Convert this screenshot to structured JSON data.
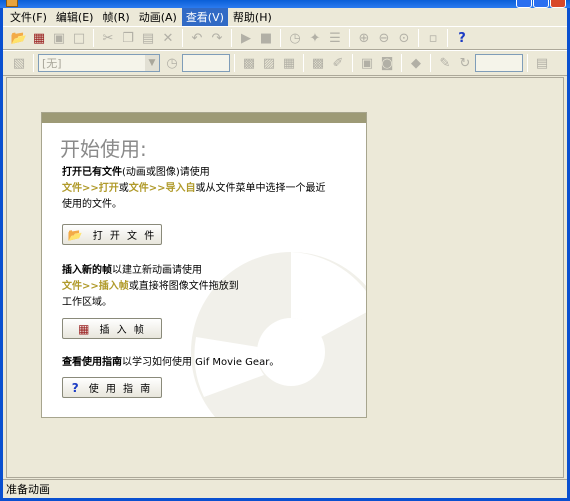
{
  "menu": [
    "文件(F)",
    "编辑(E)",
    "帧(R)",
    "动画(A)",
    "查看(V)",
    "帮助(H)"
  ],
  "toolbar2": {
    "combo_value": "[无]"
  },
  "panel": {
    "title": "开始使用:",
    "open": {
      "bold": "打开已有文件",
      "text1": "(动画或图像)请使用",
      "link1": "文件>>打开",
      "or": "或",
      "link2": "文件>>导入自",
      "text2": "或从文件菜单中选择一个最近",
      "text3": "使用的文件。",
      "button": "打 开 文 件"
    },
    "insert": {
      "bold": "插入新的帧",
      "text1": "以建立新动画请使用",
      "link": "文件>>插入帧",
      "text2": "或直接将图像文件拖放到",
      "text3": "工作区域。",
      "button": "插 入 帧"
    },
    "guide": {
      "bold": "查看使用指南",
      "text1": "以学习如何使用 Gif Movie Gear。",
      "button": "使 用 指 南"
    }
  },
  "status": "准备动画",
  "icons": [
    "app-icon",
    "open-folder-icon",
    "film-icon",
    "save-icon",
    "new-icon",
    "cut-icon",
    "copy-icon",
    "paste-icon",
    "delete-icon",
    "undo-icon",
    "redo-icon",
    "play-icon",
    "stop-icon",
    "timer-icon",
    "move-icon",
    "optimize-icon",
    "zoom-in-icon",
    "zoom-out-icon",
    "zoom-icon",
    "frame-icon",
    "help-icon"
  ]
}
